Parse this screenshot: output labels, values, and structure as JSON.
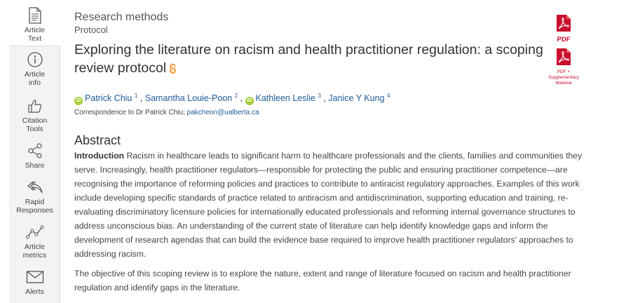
{
  "sidebar": {
    "items": [
      {
        "label": "Article\nText",
        "icon": "document-icon"
      },
      {
        "label": "Article\ninfo",
        "icon": "info-icon"
      },
      {
        "label": "Citation\nTools",
        "icon": "thumbs-up-icon"
      },
      {
        "label": "Share",
        "icon": "share-icon"
      },
      {
        "label": "Rapid\nResponses",
        "icon": "reply-icon"
      },
      {
        "label": "Article\nmetrics",
        "icon": "metrics-icon"
      },
      {
        "label": "Alerts",
        "icon": "envelope-icon"
      }
    ]
  },
  "article": {
    "section": "Research methods",
    "subsection": "Protocol",
    "title": "Exploring the literature on racism and health practitioner regulation: a scoping review protocol",
    "authors": [
      {
        "name": "Patrick Chiu",
        "sup": "1",
        "orcid": true
      },
      {
        "name": "Samantha Louie-Poon",
        "sup": "2",
        "orcid": false
      },
      {
        "name": "Kathleen Leslie",
        "sup": "3",
        "orcid": true
      },
      {
        "name": "Janice Y Kung",
        "sup": "4",
        "orcid": false
      }
    ],
    "correspondence_prefix": "Correspondence to Dr Patrick Chiu;",
    "correspondence_email": "pakcheon@ualberta.ca",
    "abstract_heading": "Abstract",
    "intro_label": "Introduction",
    "intro_text": " Racism in healthcare leads to significant harm to healthcare professionals and the clients, families and communities they serve. Increasingly, health practitioner regulators—responsible for protecting the public and ensuring practitioner competence—are recognising the importance of reforming policies and practices to contribute to antiracist regulatory approaches. Examples of this work include developing specific standards of practice related to antiracism and antidiscrimination, supporting education and training, re-evaluating discriminatory licensure policies for internationally educated professionals and reforming internal governance structures to address unconscious bias. An understanding of the current state of literature can help identify knowledge gaps and inform the development of research agendas that can build the evidence base required to improve health practitioner regulators' approaches to addressing racism.",
    "objective_text": "The objective of this scoping review is to explore the nature, extent and range of literature focused on racism and health practitioner regulation and identify gaps in the literature."
  },
  "downloads": {
    "pdf_label": "PDF",
    "pdf_supp_label": "PDF +\nSupplementary\nMaterial"
  },
  "colors": {
    "link": "#1f5c99",
    "pdf_red": "#c8102e",
    "orcid_green": "#a6ce39",
    "open_access_orange": "#f68212"
  }
}
